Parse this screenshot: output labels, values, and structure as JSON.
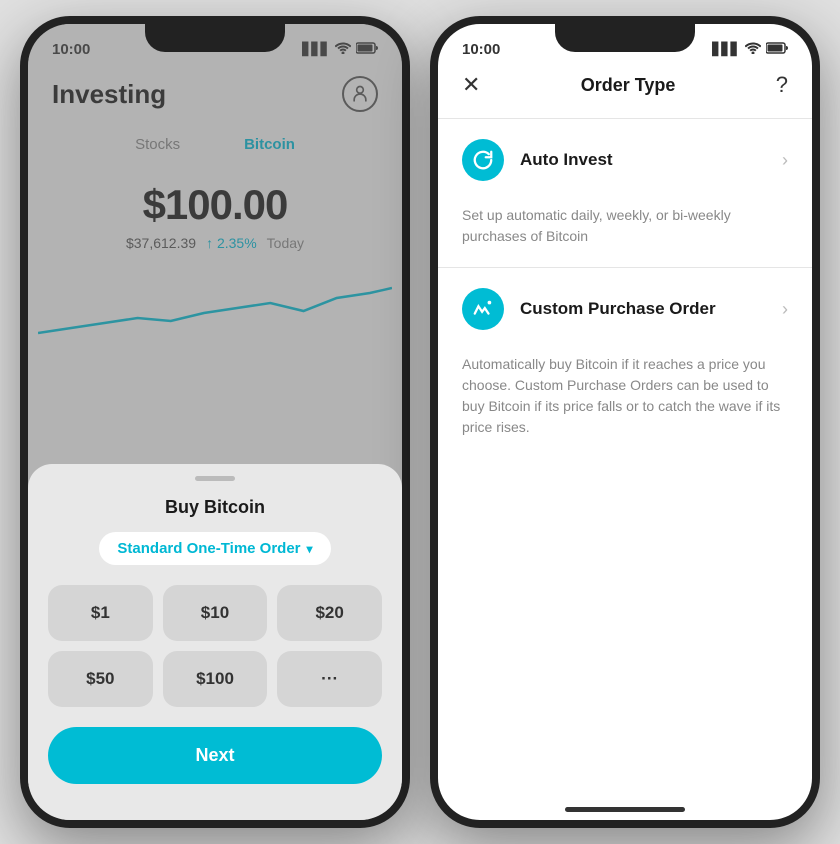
{
  "left_phone": {
    "status": {
      "time": "10:00",
      "signal": "▋▋▋",
      "wifi": "wifi",
      "battery": "battery"
    },
    "header": {
      "title": "Investing",
      "profile_icon": "👤"
    },
    "tabs": [
      {
        "label": "Stocks",
        "active": false
      },
      {
        "label": "Bitcoin",
        "active": true
      }
    ],
    "price": {
      "main": "$100.00",
      "btc": "$37,612.39",
      "change": "↑ 2.35%",
      "period": "Today"
    },
    "bottom_sheet": {
      "title": "Buy Bitcoin",
      "order_type": "Standard One-Time Order",
      "amounts": [
        "$1",
        "$10",
        "$20",
        "$50",
        "$100",
        "···"
      ],
      "next_btn": "Next"
    }
  },
  "right_phone": {
    "status": {
      "time": "10:00"
    },
    "header": {
      "close": "✕",
      "title": "Order Type",
      "help": "?"
    },
    "items": [
      {
        "id": "auto-invest",
        "icon": "↺",
        "label": "Auto Invest",
        "description": "Set up automatic daily, weekly, or bi-weekly purchases of Bitcoin"
      },
      {
        "id": "custom-purchase",
        "icon": "↗",
        "label": "Custom Purchase Order",
        "description": "Automatically buy Bitcoin if it reaches a price you choose. Custom Purchase Orders can be used to buy Bitcoin if its price falls or to catch the wave if its price rises."
      }
    ]
  }
}
